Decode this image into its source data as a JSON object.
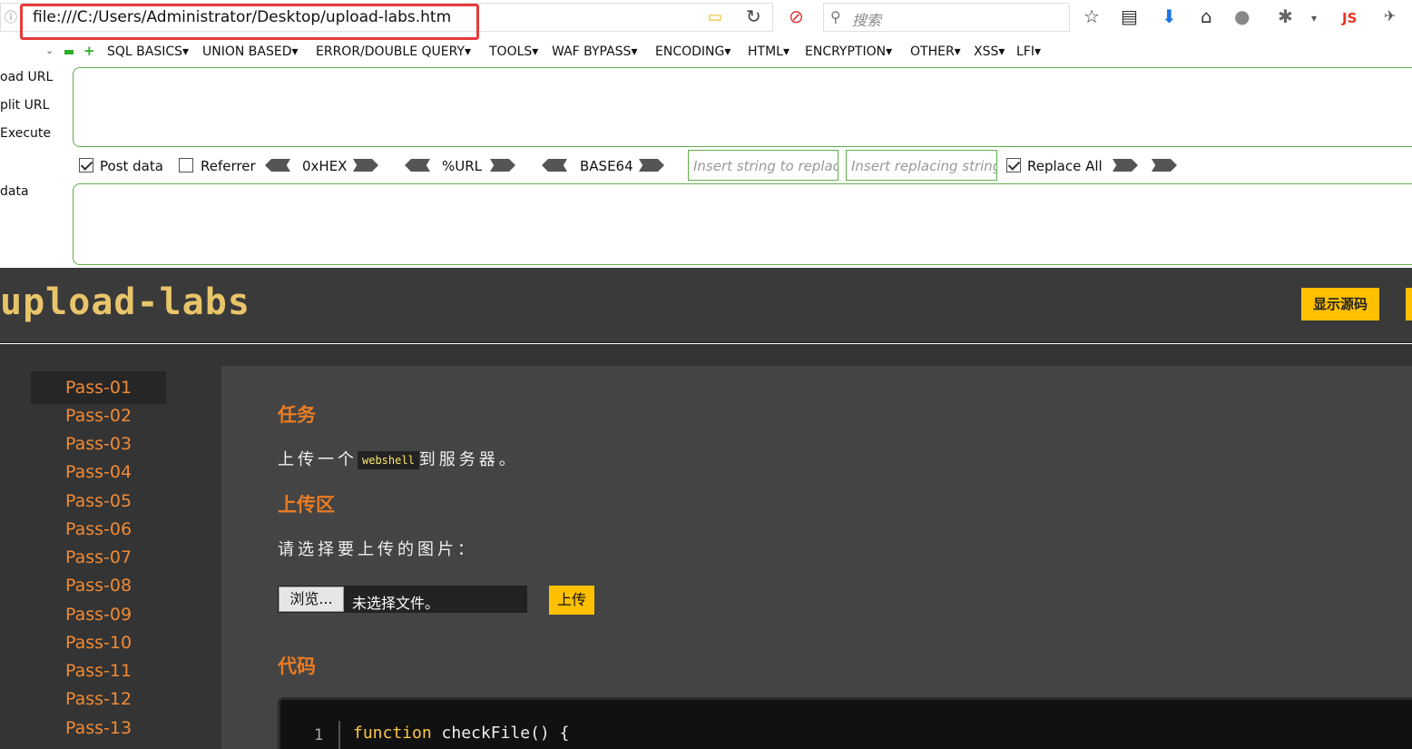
{
  "browser": {
    "url": "file:///C:/Users/Administrator/Desktop/upload-labs.htm",
    "search_placeholder": "搜索",
    "js_label": "JS"
  },
  "hackbar": {
    "menu": [
      "SQL BASICS",
      "UNION BASED",
      "ERROR/DOUBLE QUERY",
      "TOOLS",
      "WAF BYPASS",
      "ENCODING",
      "HTML",
      "ENCRYPTION",
      "OTHER",
      "XSS",
      "LFI"
    ],
    "side_labels": {
      "load": "oad URL",
      "split": "plit URL",
      "execute": "Execute",
      "data": "data"
    },
    "post_data_label": "Post data",
    "post_data_checked": true,
    "referrer_label": "Referrer",
    "referrer_checked": false,
    "hex_label": "0xHEX",
    "url_label": "%URL",
    "base64_label": "BASE64",
    "replace_placeholder": "Insert string to replace",
    "replacing_placeholder": "Insert replacing string",
    "replace_all_label": "Replace All",
    "replace_all_checked": true
  },
  "page": {
    "logo": "upload-labs",
    "show_source_button": "显示源码",
    "passes": [
      "Pass-01",
      "Pass-02",
      "Pass-03",
      "Pass-04",
      "Pass-05",
      "Pass-06",
      "Pass-07",
      "Pass-08",
      "Pass-09",
      "Pass-10",
      "Pass-11",
      "Pass-12",
      "Pass-13"
    ],
    "active_pass": "Pass-01",
    "task_heading": "任务",
    "task_text_before": "上传一个",
    "task_code": "webshell",
    "task_text_after": "到服务器。",
    "upload_heading": "上传区",
    "upload_prompt": "请选择要上传的图片：",
    "browse_button": "浏览...",
    "no_file_text": "未选择文件。",
    "upload_button": "上传",
    "code_heading": "代码",
    "code_line_number": "1",
    "code_keyword": "function",
    "code_rest": " checkFile() {"
  },
  "colors": {
    "accent_orange": "#e87c24",
    "button_yellow": "#ffc000",
    "highlight_red": "#e53b3b"
  }
}
